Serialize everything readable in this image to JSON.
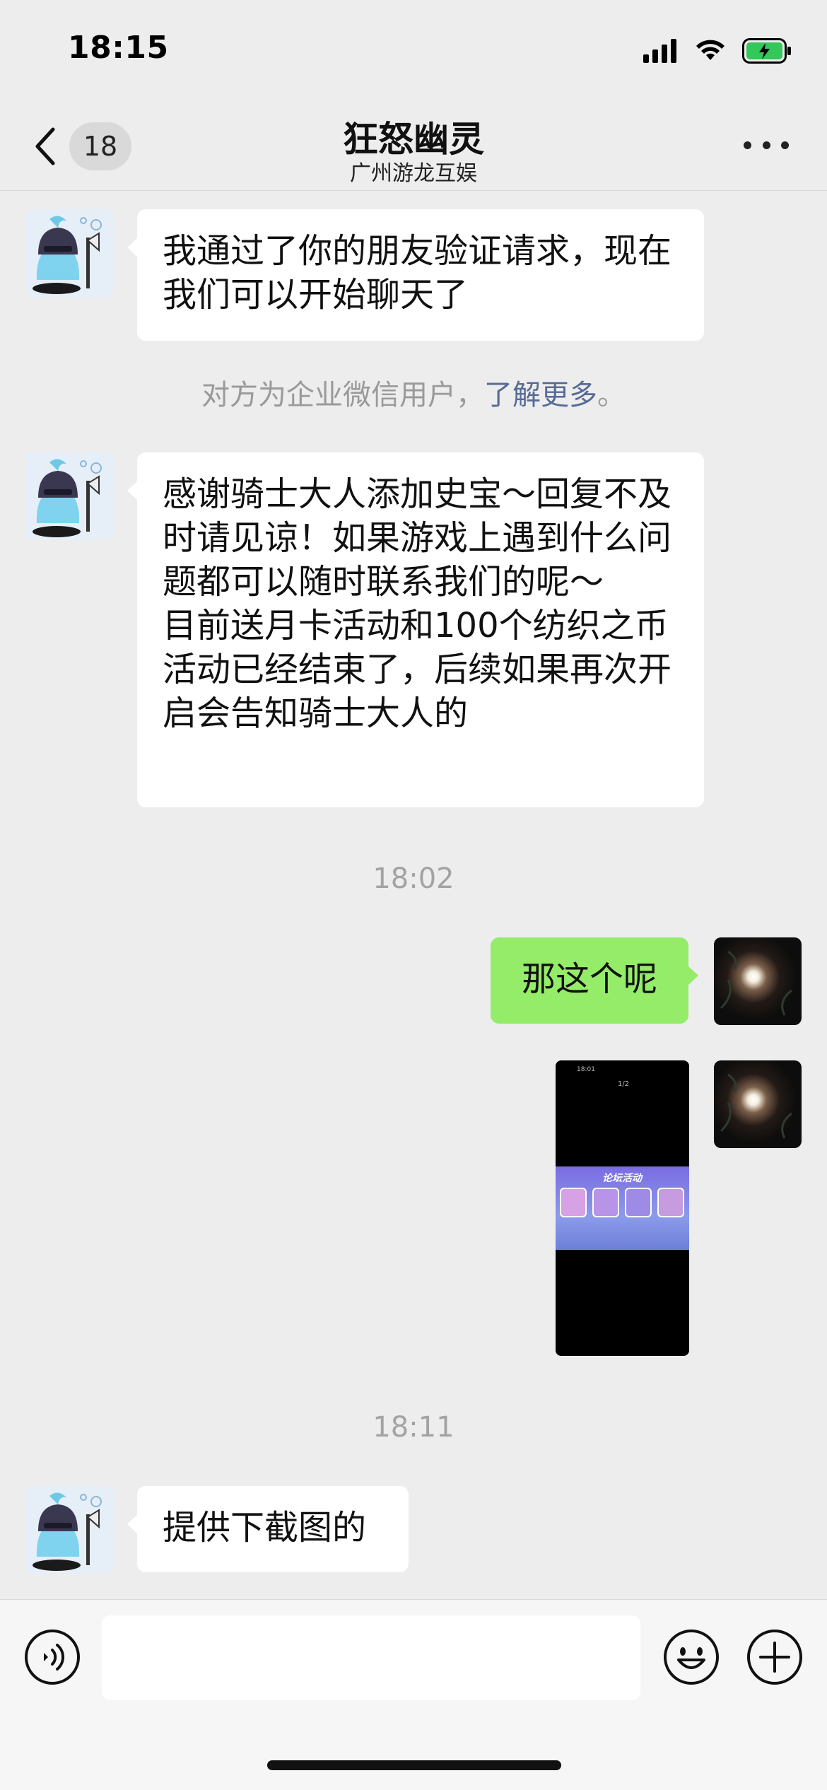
{
  "status_bar": {
    "time": "18:15"
  },
  "header": {
    "unread_count": "18",
    "title": "狂怒幽灵",
    "subtitle": "广州游龙互娱"
  },
  "messages": [
    {
      "id": "m1",
      "side": "left",
      "text": "我通过了你的朋友验证请求，现在我们可以开始聊天了"
    },
    {
      "id": "sys1",
      "type": "system",
      "text": "对方为企业微信用户，",
      "link": "了解更多",
      "suffix": "。"
    },
    {
      "id": "m2",
      "side": "left",
      "text": "感谢骑士大人添加史宝～回复不及时请见谅！如果游戏上遇到什么问题都可以随时联系我们的呢～\n目前送月卡活动和100个纺织之币活动已经结束了，后续如果再次开启会告知骑士大人的"
    },
    {
      "id": "t1",
      "type": "timestamp",
      "text": "18:02"
    },
    {
      "id": "m3",
      "side": "right",
      "text": "那这个呢"
    },
    {
      "id": "m4",
      "side": "right",
      "type": "image",
      "inner_page": "1/2",
      "inner_time": "18:01",
      "inner_banner": "论坛活动"
    },
    {
      "id": "t2",
      "type": "timestamp",
      "text": "18:11"
    },
    {
      "id": "m5",
      "side": "left",
      "text": "提供下截图的"
    }
  ],
  "input": {
    "value": "",
    "placeholder": ""
  },
  "icons": {
    "back": "chevron-left-icon",
    "more": "more-dots-icon",
    "voice": "voice-icon",
    "emoji": "emoji-icon",
    "plus": "plus-icon"
  },
  "colors": {
    "background": "#EDEDED",
    "bubble_left": "#FFFFFF",
    "bubble_right": "#95EC69",
    "link": "#576B95",
    "battery": "#34C759"
  }
}
